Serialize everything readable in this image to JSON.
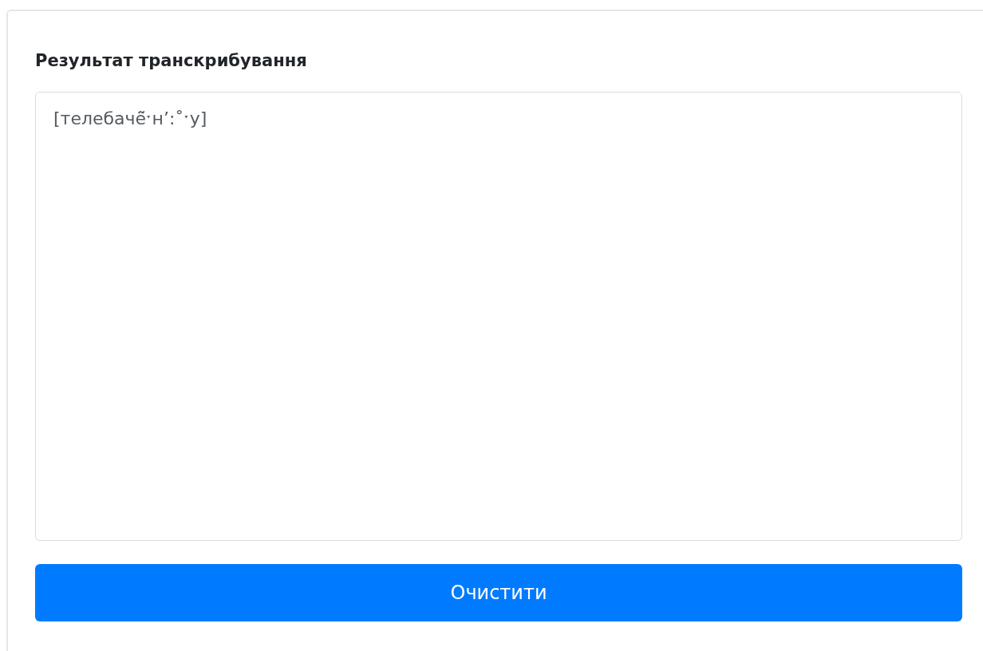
{
  "card": {
    "title": "Результат транскрибування",
    "result": {
      "value": "[телебачё̃ˑн’:˚ˑу]"
    },
    "buttons": [
      {
        "label": "Очистити",
        "kind": "primary"
      }
    ]
  }
}
